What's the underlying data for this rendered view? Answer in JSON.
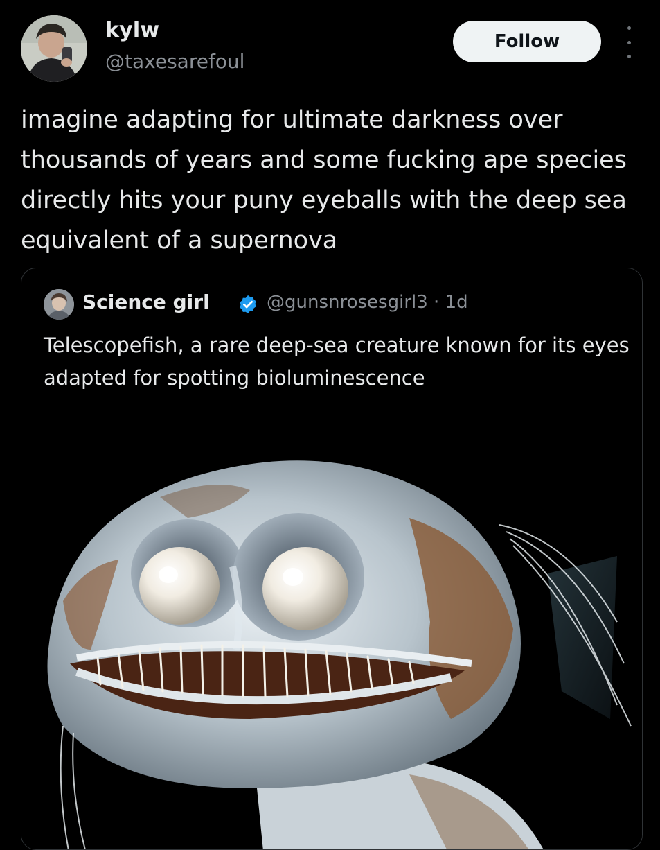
{
  "post": {
    "display_name": "kylw",
    "handle": "@taxesarefoul",
    "follow_label": "Follow",
    "text": "imagine adapting for ultimate darkness over thousands of years and some fucking ape species directly hits your puny eyeballs with the deep sea equivalent of a supernova",
    "icons": {
      "avatar": "user-avatar",
      "more": "more-options-icon"
    }
  },
  "quoted_post": {
    "display_name": "Science girl",
    "handle": "@gunsnrosesgirl3",
    "separator": "·",
    "time": "1d",
    "meta": "@gunsnrosesgirl3 · 1d",
    "text": "Telescopefish, a rare deep-sea creature known for its eyes adapted for spotting bioluminescence",
    "icons": {
      "verified": "verified-badge-icon"
    }
  },
  "colors": {
    "background": "#000000",
    "primary_text": "#e7e9ea",
    "secondary_text": "#8b9096",
    "follow_button_bg": "#eff3f4",
    "verified_blue": "#1d9bf0",
    "card_border": "#2f3336"
  }
}
